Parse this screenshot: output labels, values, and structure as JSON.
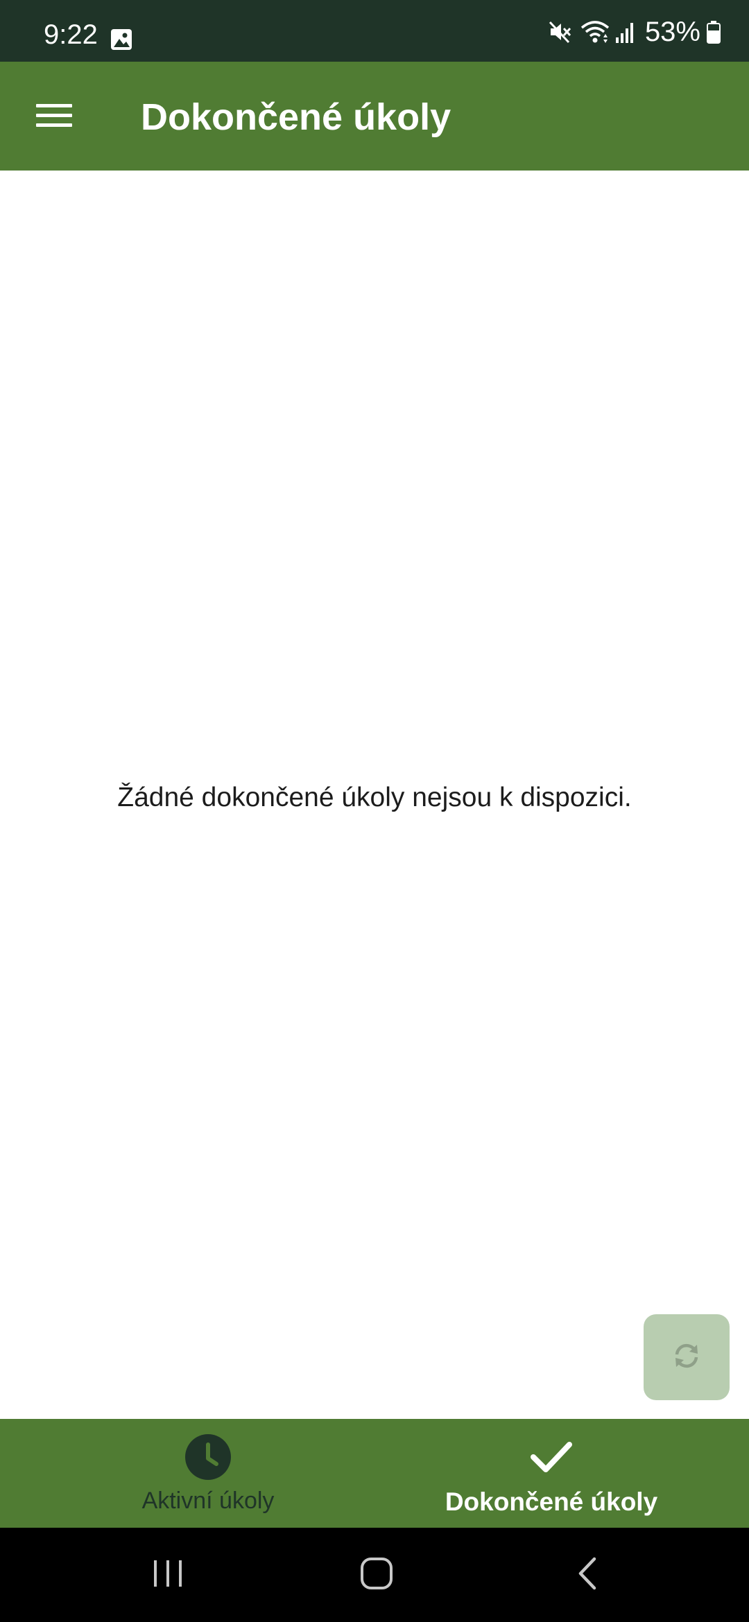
{
  "status_bar": {
    "time": "9:22",
    "battery": "53%",
    "icons": [
      "gallery-icon",
      "mute-icon",
      "wifi-icon",
      "signal-icon",
      "battery-icon"
    ]
  },
  "app_bar": {
    "title": "Dokončené úkoly",
    "menu_icon": "hamburger-menu-icon"
  },
  "content": {
    "empty_message": "Žádné dokončené úkoly nejsou k dispozici."
  },
  "fab": {
    "icon": "refresh-icon"
  },
  "bottom_nav": {
    "items": [
      {
        "label": "Aktivní úkoly",
        "icon": "clock-icon",
        "active": false
      },
      {
        "label": "Dokončené úkoly",
        "icon": "checkmark-icon",
        "active": true
      }
    ]
  },
  "system_nav": {
    "buttons": [
      "recent-apps-icon",
      "home-icon",
      "back-icon"
    ]
  },
  "colors": {
    "status_bar": "#1f3428",
    "primary": "#507c33",
    "fab_background": "#b8cdb0",
    "inactive_nav": "#1f3428",
    "active_nav": "#ffffff"
  }
}
